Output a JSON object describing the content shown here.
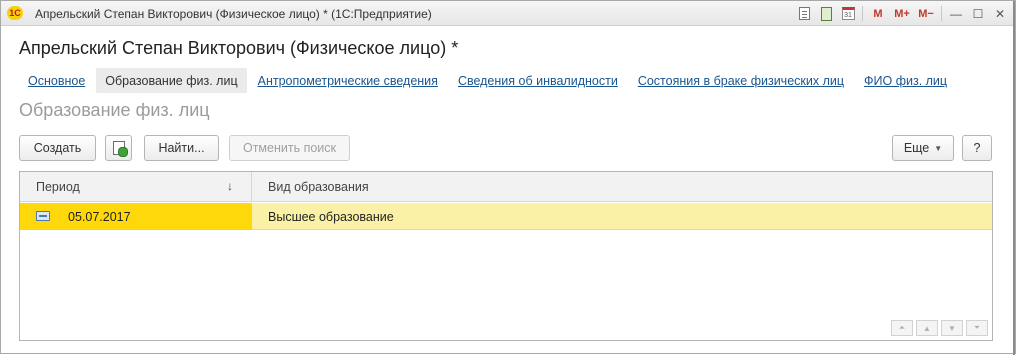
{
  "window": {
    "logo": "1С",
    "title": "Апрельский Степан Викторович (Физическое лицо) *  (1С:Предприятие)"
  },
  "titlebar_icons": [
    "print-doc-icon",
    "calculator-icon",
    "calendar-icon",
    "M",
    "M+",
    "M−",
    "minimize-icon",
    "maximize-icon",
    "close-icon"
  ],
  "titlebar_labels": {
    "m": "M",
    "m_plus": "M+",
    "m_minus": "M−",
    "calendar_day": "31",
    "minimize": "—",
    "maximize": "☐",
    "close": "✕"
  },
  "form": {
    "title": "Апрельский Степан Викторович (Физическое лицо) *",
    "tabs": [
      {
        "label": "Основное",
        "active": false
      },
      {
        "label": "Образование физ. лиц",
        "active": true
      },
      {
        "label": "Антропометрические сведения",
        "active": false
      },
      {
        "label": "Сведения об инвалидности",
        "active": false
      },
      {
        "label": "Состояния в браке физических лиц",
        "active": false
      },
      {
        "label": "ФИО физ. лиц",
        "active": false
      }
    ],
    "section_title": "Образование физ. лиц"
  },
  "toolbar": {
    "create": "Создать",
    "find": "Найти...",
    "cancel_search": "Отменить поиск",
    "more": "Еще",
    "help": "?"
  },
  "table": {
    "columns": [
      "Период",
      "Вид образования"
    ],
    "sort_indicator": "↓",
    "rows": [
      {
        "period": "05.07.2017",
        "kind": "Высшее образование",
        "selected": true
      }
    ],
    "pager": [
      "⏶",
      "▲",
      "▼",
      "⏷"
    ]
  },
  "colors": {
    "selected_cell": "#ffd80b",
    "selected_row": "#fbf1a6",
    "link": "#1a5690",
    "section_title": "#9b9b9b"
  }
}
